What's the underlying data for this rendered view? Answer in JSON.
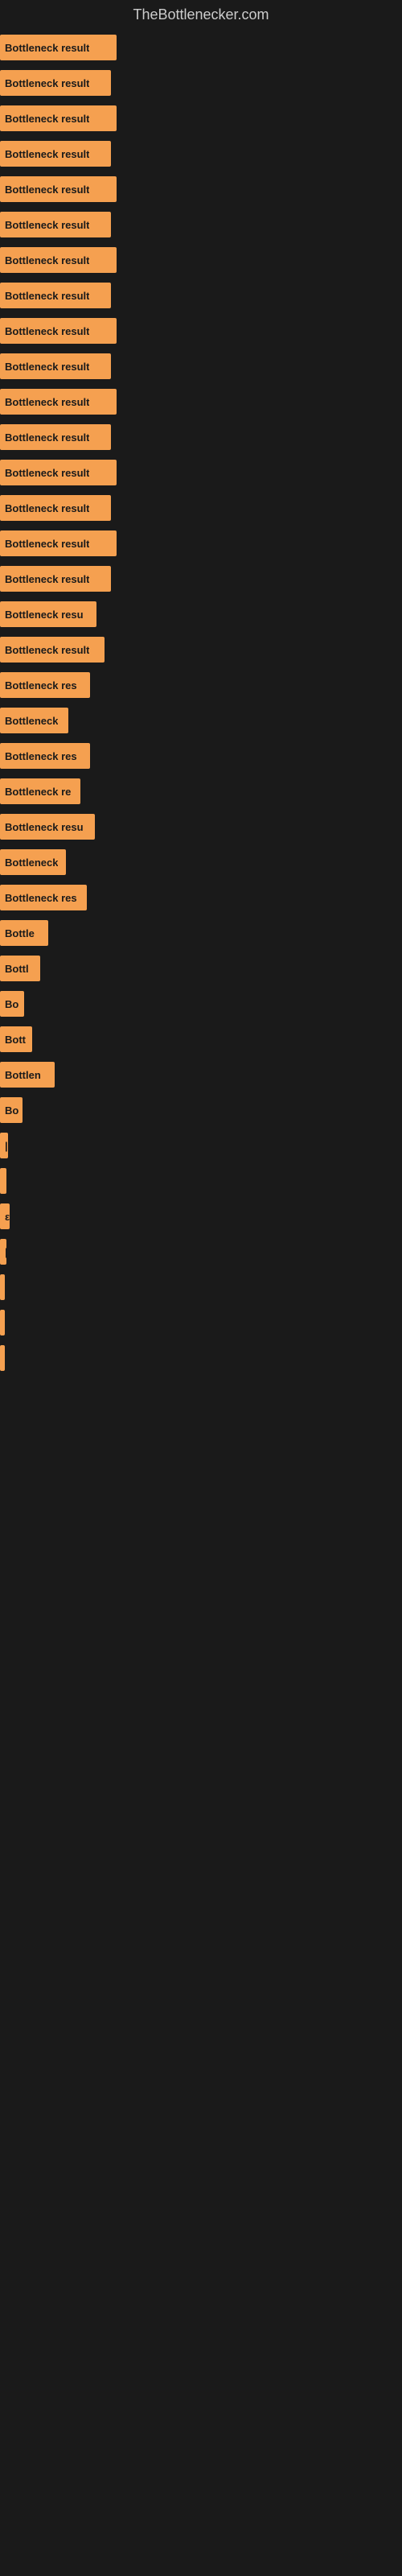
{
  "site_title": "TheBottlenecker.com",
  "bars": [
    {
      "label": "Bottleneck result",
      "width": 145
    },
    {
      "label": "Bottleneck result",
      "width": 138
    },
    {
      "label": "Bottleneck result",
      "width": 145
    },
    {
      "label": "Bottleneck result",
      "width": 138
    },
    {
      "label": "Bottleneck result",
      "width": 145
    },
    {
      "label": "Bottleneck result",
      "width": 138
    },
    {
      "label": "Bottleneck result",
      "width": 145
    },
    {
      "label": "Bottleneck result",
      "width": 138
    },
    {
      "label": "Bottleneck result",
      "width": 145
    },
    {
      "label": "Bottleneck result",
      "width": 138
    },
    {
      "label": "Bottleneck result",
      "width": 145
    },
    {
      "label": "Bottleneck result",
      "width": 138
    },
    {
      "label": "Bottleneck result",
      "width": 145
    },
    {
      "label": "Bottleneck result",
      "width": 138
    },
    {
      "label": "Bottleneck result",
      "width": 145
    },
    {
      "label": "Bottleneck result",
      "width": 138
    },
    {
      "label": "Bottleneck resu",
      "width": 120
    },
    {
      "label": "Bottleneck result",
      "width": 130
    },
    {
      "label": "Bottleneck res",
      "width": 112
    },
    {
      "label": "Bottleneck",
      "width": 85
    },
    {
      "label": "Bottleneck res",
      "width": 112
    },
    {
      "label": "Bottleneck re",
      "width": 100
    },
    {
      "label": "Bottleneck resu",
      "width": 118
    },
    {
      "label": "Bottleneck",
      "width": 82
    },
    {
      "label": "Bottleneck res",
      "width": 108
    },
    {
      "label": "Bottle",
      "width": 60
    },
    {
      "label": "Bottl",
      "width": 50
    },
    {
      "label": "Bo",
      "width": 30
    },
    {
      "label": "Bott",
      "width": 40
    },
    {
      "label": "Bottlen",
      "width": 68
    },
    {
      "label": "Bo",
      "width": 28
    },
    {
      "label": "|",
      "width": 10
    },
    {
      "label": "",
      "width": 8
    },
    {
      "label": "ε",
      "width": 12
    },
    {
      "label": "|",
      "width": 8
    },
    {
      "label": "",
      "width": 6
    },
    {
      "label": "",
      "width": 4
    },
    {
      "label": "",
      "width": 4
    }
  ]
}
